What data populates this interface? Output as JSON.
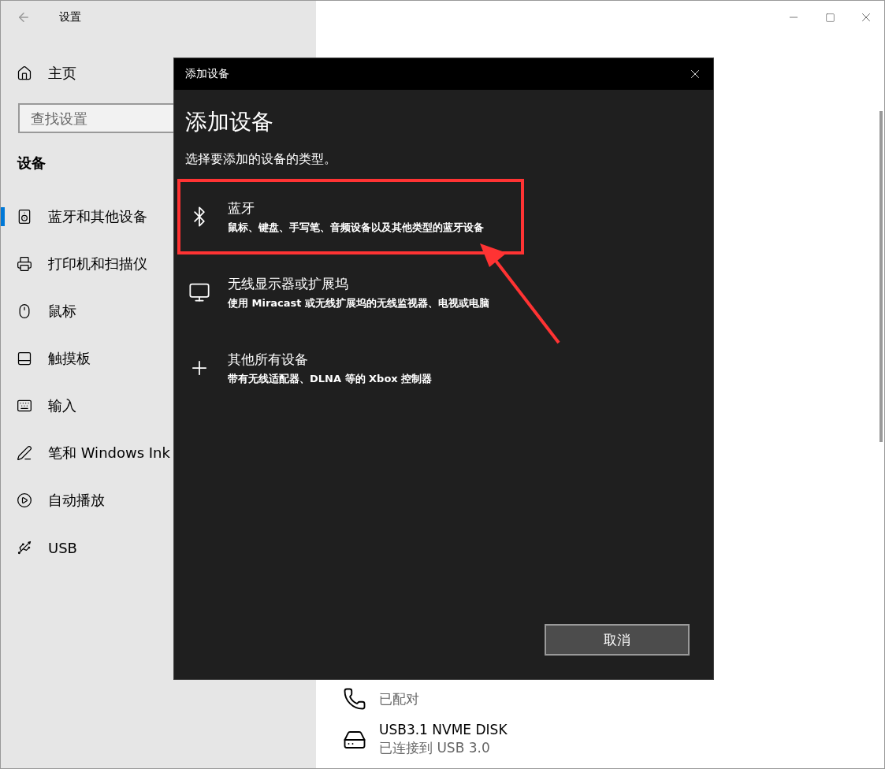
{
  "window": {
    "title": "设置"
  },
  "sidebar": {
    "home": "主页",
    "search": {
      "placeholder": "查找设置"
    },
    "section": "设备",
    "items": [
      {
        "kind": "bluetooth",
        "label": "蓝牙和其他设备",
        "selected": true
      },
      {
        "kind": "printer",
        "label": "打印机和扫描仪",
        "selected": false
      },
      {
        "kind": "mouse",
        "label": "鼠标",
        "selected": false
      },
      {
        "kind": "touchpad",
        "label": "触摸板",
        "selected": false
      },
      {
        "kind": "keyboard",
        "label": "输入",
        "selected": false
      },
      {
        "kind": "pen",
        "label": "笔和 Windows Ink",
        "selected": false
      },
      {
        "kind": "autoplay",
        "label": "自动播放",
        "selected": false
      },
      {
        "kind": "usb",
        "label": "USB",
        "selected": false
      }
    ]
  },
  "devices": [
    {
      "kind": "phone",
      "status": "已配对"
    },
    {
      "kind": "disk",
      "name": "USB3.1 NVME DISK",
      "status": "已连接到 USB 3.0"
    }
  ],
  "dialog": {
    "title": "添加设备",
    "heading": "添加设备",
    "subtitle": "选择要添加的设备的类型。",
    "options": [
      {
        "kind": "bluetooth",
        "title": "蓝牙",
        "description": "鼠标、键盘、手写笔、音频设备以及其他类型的蓝牙设备",
        "highlighted": true
      },
      {
        "kind": "display",
        "title": "无线显示器或扩展坞",
        "description": "使用 Miracast 或无线扩展坞的无线监视器、电视或电脑",
        "highlighted": false
      },
      {
        "kind": "other",
        "title": "其他所有设备",
        "description": "带有无线适配器、DLNA 等的 Xbox 控制器",
        "highlighted": false
      }
    ],
    "cancel": "取消"
  }
}
